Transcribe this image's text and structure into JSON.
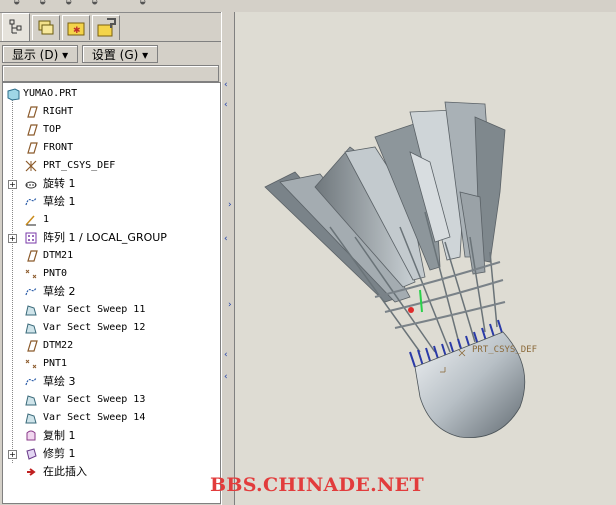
{
  "toolbar": {
    "show_label": "显示 (D) ▾",
    "settings_label": "设置 (G) ▾"
  },
  "model_tree": {
    "root": "YUMAO.PRT",
    "items": [
      {
        "label": "RIGHT",
        "icon": "datum-plane-icon",
        "expandable": false
      },
      {
        "label": "TOP",
        "icon": "datum-plane-icon",
        "expandable": false
      },
      {
        "label": "FRONT",
        "icon": "datum-plane-icon",
        "expandable": false
      },
      {
        "label": "PRT_CSYS_DEF",
        "icon": "coordinate-system-icon",
        "expandable": false
      },
      {
        "label": "旋转 1",
        "icon": "revolve-icon",
        "expandable": true
      },
      {
        "label": "草绘 1",
        "icon": "sketch-icon",
        "expandable": false
      },
      {
        "label": "1",
        "icon": "datum-axis-icon",
        "expandable": false
      },
      {
        "label": "阵列 1 / LOCAL_GROUP",
        "icon": "pattern-icon",
        "expandable": true
      },
      {
        "label": "DTM21",
        "icon": "datum-plane-icon",
        "expandable": false
      },
      {
        "label": "PNT0",
        "icon": "datum-point-icon",
        "expandable": false
      },
      {
        "label": "草绘 2",
        "icon": "sketch-icon",
        "expandable": false
      },
      {
        "label": "Var Sect Sweep 11",
        "icon": "sweep-icon",
        "expandable": false
      },
      {
        "label": "Var Sect Sweep 12",
        "icon": "sweep-icon",
        "expandable": false
      },
      {
        "label": "DTM22",
        "icon": "datum-plane-icon",
        "expandable": false
      },
      {
        "label": "PNT1",
        "icon": "datum-point-icon",
        "expandable": false
      },
      {
        "label": "草绘 3",
        "icon": "sketch-icon",
        "expandable": false
      },
      {
        "label": "Var Sect Sweep 13",
        "icon": "sweep-icon",
        "expandable": false
      },
      {
        "label": "Var Sect Sweep 14",
        "icon": "sweep-icon",
        "expandable": false
      },
      {
        "label": "复制 1",
        "icon": "copy-icon",
        "expandable": false
      },
      {
        "label": "修剪 1",
        "icon": "trim-icon",
        "expandable": true
      },
      {
        "label": "在此插入",
        "icon": "insert-here-icon",
        "expandable": false
      }
    ]
  },
  "viewport": {
    "csys_label": "PRT_CSYS_DEF"
  },
  "watermark": "BBS.CHINADE.NET",
  "colors": {
    "background": "#dedcd3",
    "shuttle_gray": "#a7afb3",
    "blue_bands": "#2a3aa8",
    "watermark": "#e23c3c"
  }
}
